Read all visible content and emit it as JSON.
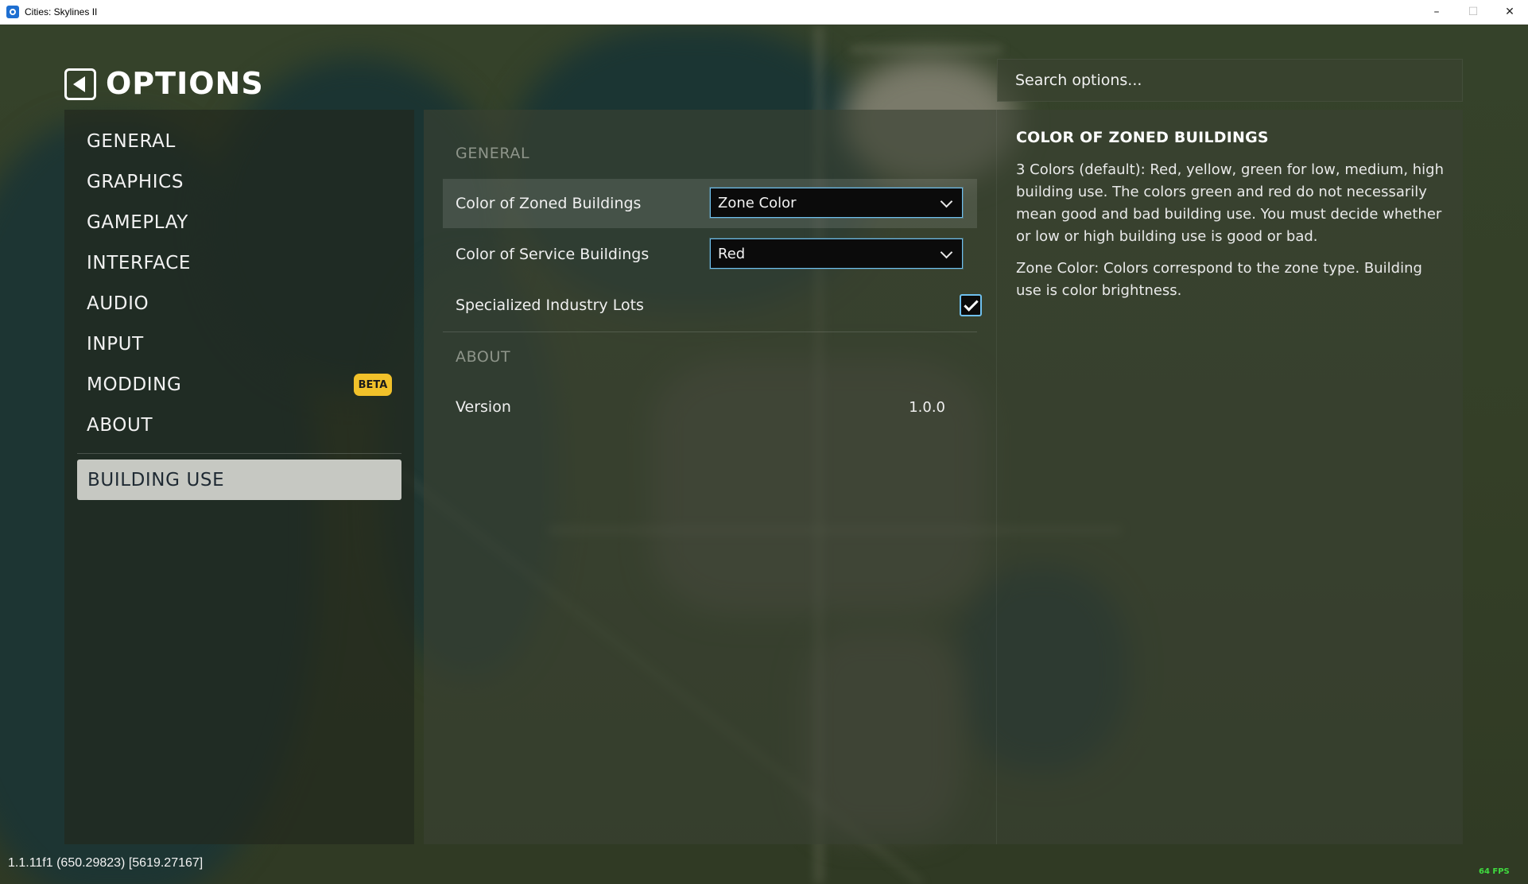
{
  "window": {
    "title": "Cities: Skylines II",
    "minimize": "–",
    "maximize": "☐",
    "close": "✕"
  },
  "header": {
    "title": "OPTIONS",
    "back_icon": "back-arrow-icon",
    "search_placeholder": "Search options..."
  },
  "categories": [
    {
      "label": "GENERAL"
    },
    {
      "label": "GRAPHICS"
    },
    {
      "label": "GAMEPLAY"
    },
    {
      "label": "INTERFACE"
    },
    {
      "label": "AUDIO"
    },
    {
      "label": "INPUT"
    },
    {
      "label": "MODDING",
      "badge": "BETA"
    },
    {
      "label": "ABOUT"
    }
  ],
  "selected_category": "BUILDING USE",
  "settings": {
    "general_header": "GENERAL",
    "zoned_label": "Color of Zoned Buildings",
    "zoned_value": "Zone Color",
    "service_label": "Color of Service Buildings",
    "service_value": "Red",
    "industry_label": "Specialized Industry Lots",
    "industry_checked": true,
    "about_header": "ABOUT",
    "version_label": "Version",
    "version_value": "1.0.0"
  },
  "description": {
    "title": "COLOR OF ZONED BUILDINGS",
    "para1": "3 Colors (default): Red, yellow, green for low, medium, high building use. The colors green and red do not necessarily mean good and bad building use. You must decide whether or low or high building use is good or bad.",
    "para2": "Zone Color: Colors correspond to the zone type. Building use is color brightness."
  },
  "footer": {
    "build_info": "1.1.11f1 (650.29823) [5619.27167]",
    "fps": "64 FPS"
  },
  "colors": {
    "badge": "#f1c12a",
    "accent_border": "#6fc0ee",
    "selected_bg": "#c6c8c2",
    "fps": "#3fdc3f"
  }
}
